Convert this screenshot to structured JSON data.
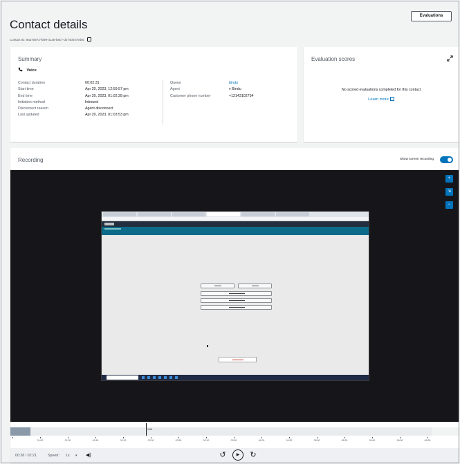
{
  "header": {
    "title": "Contact details",
    "contact_id": "Contact ID: 9aa70872-f099-4136-b8c7-d2740047ed8c",
    "evaluations_button": "Evaluations"
  },
  "summary": {
    "title": "Summary",
    "channel": "Voice",
    "left_fields": [
      {
        "label": "Contact duration",
        "value": "00:02:31"
      },
      {
        "label": "Start time",
        "value": "Apr 20, 2023, 12:59:57 pm"
      },
      {
        "label": "End time",
        "value": "Apr 20, 2023, 01:02:28 pm"
      },
      {
        "label": "Initiation method",
        "value": "Inbound"
      },
      {
        "label": "Disconnect reason",
        "value": "Agent disconnect"
      },
      {
        "label": "Last updated",
        "value": "Apr 20, 2023, 01:03:53 pm"
      }
    ],
    "right_fields": [
      {
        "label": "Queue",
        "value": "bindu"
      },
      {
        "label": "Agent",
        "value": "v Bindu"
      },
      {
        "label": "Customer phone number",
        "value": "+12143102754"
      }
    ]
  },
  "evaluation_scores": {
    "title": "Evaluation scores",
    "empty_text": "No scored evaluations completed for this contact",
    "learn_more": "Learn more"
  },
  "recording": {
    "title": "Recording",
    "show_screen_label": "Show screen recording",
    "show_screen_enabled": true,
    "marker_label": "1:04",
    "tick_labels": [
      "00:20",
      "01:00",
      "01:30",
      "01:50",
      "02:10",
      "02:30",
      "02:50",
      "03:10",
      "03:30",
      "04:00",
      "04:30",
      "05:00",
      "05:20",
      "05:40",
      "06:00",
      "06:30"
    ],
    "time_display": "00:28 / 02:21",
    "speed_label": "Speed:",
    "speed_value": "1x",
    "played_fraction": 0.045
  },
  "colors": {
    "accent": "#0073bb",
    "video_bg": "#16161a"
  }
}
